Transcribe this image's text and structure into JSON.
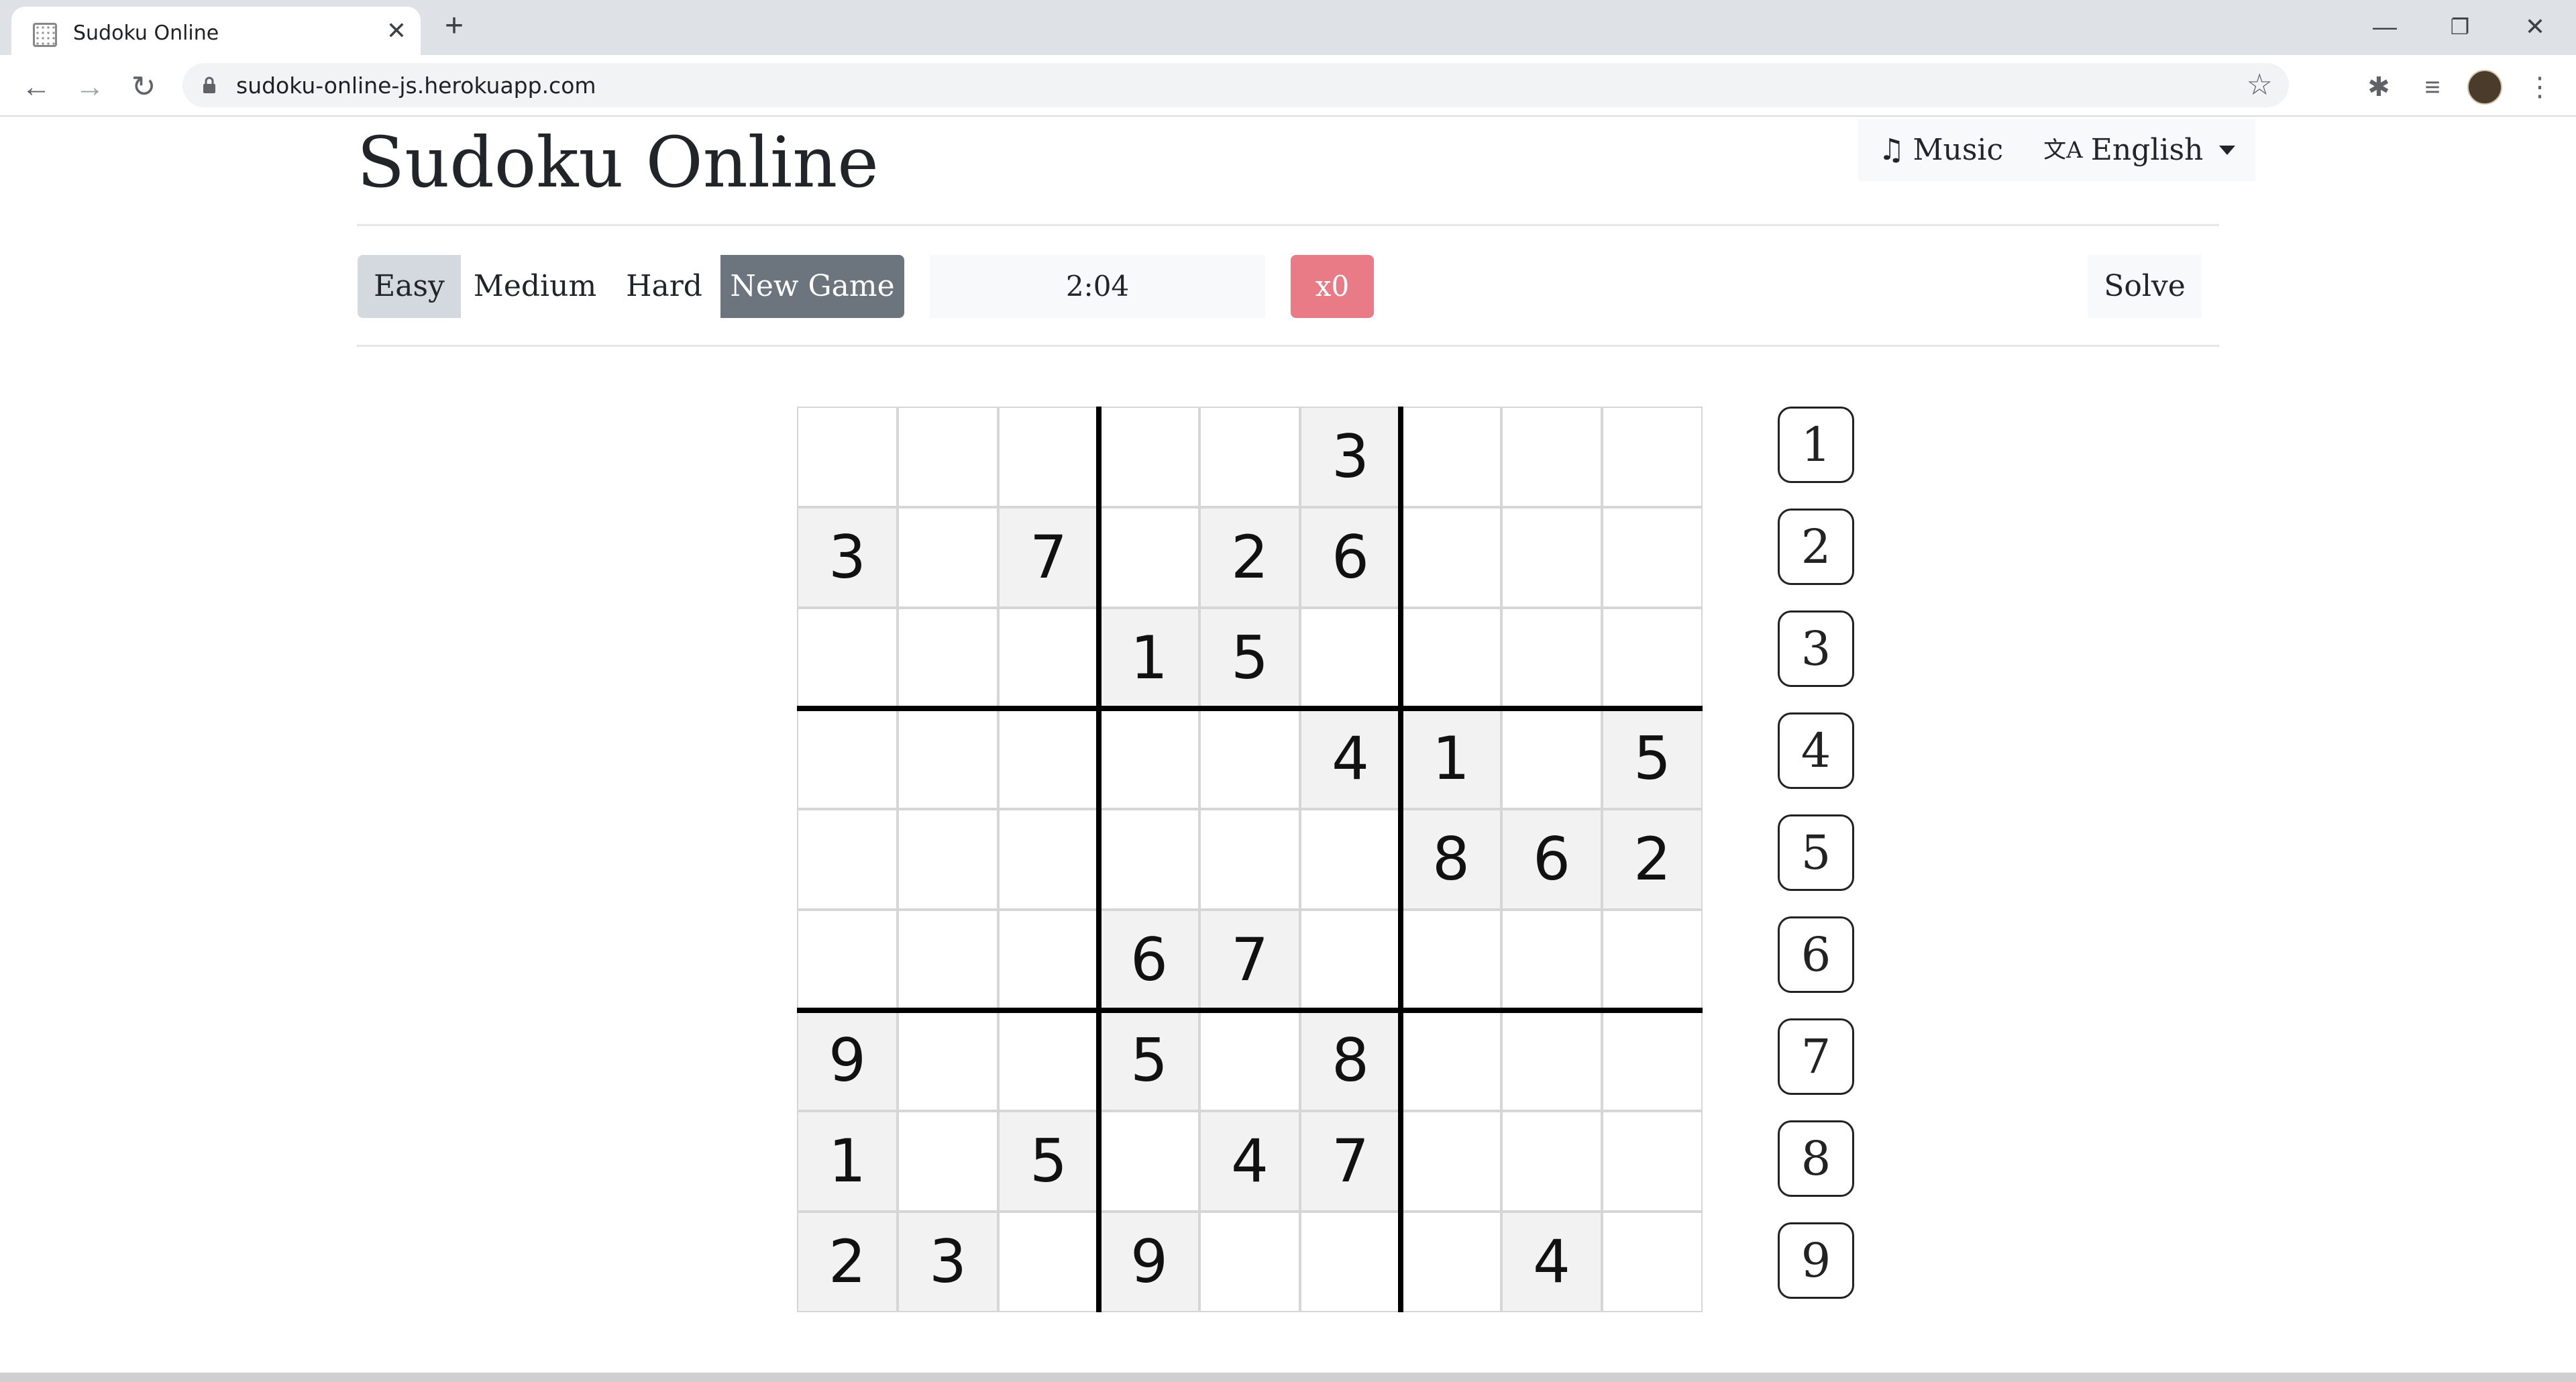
{
  "browser": {
    "tab_title": "Sudoku Online",
    "url": "sudoku-online-js.herokuapp.com"
  },
  "page": {
    "title": "Sudoku Online",
    "music_label": "Music",
    "language_label": "English",
    "difficulty": [
      "Easy",
      "Medium",
      "Hard"
    ],
    "selected_difficulty": "Easy",
    "new_game_label": "New Game",
    "timer": "2:04",
    "mistakes": "x0",
    "solve_label": "Solve"
  },
  "board": [
    [
      "",
      "",
      "",
      "",
      "",
      "3",
      "",
      "",
      ""
    ],
    [
      "3",
      "",
      "7",
      "",
      "2",
      "6",
      "",
      "",
      ""
    ],
    [
      "",
      "",
      "",
      "1",
      "5",
      "",
      "",
      "",
      ""
    ],
    [
      "",
      "",
      "",
      "",
      "",
      "4",
      "1",
      "",
      "5"
    ],
    [
      "",
      "",
      "",
      "",
      "",
      "",
      "8",
      "6",
      "2"
    ],
    [
      "",
      "",
      "",
      "6",
      "7",
      "",
      "",
      "",
      ""
    ],
    [
      "9",
      "",
      "",
      "5",
      "",
      "8",
      "",
      "",
      ""
    ],
    [
      "1",
      "",
      "5",
      "",
      "4",
      "7",
      "",
      "",
      ""
    ],
    [
      "2",
      "3",
      "",
      "9",
      "",
      "",
      "",
      "4",
      ""
    ]
  ],
  "numpad": [
    "1",
    "2",
    "3",
    "4",
    "5",
    "6",
    "7",
    "8",
    "9"
  ],
  "colors": {
    "given_cell_bg": "#f2f2f2",
    "new_game_bg": "#6c757d",
    "mistakes_bg": "#e97b86",
    "selected_difficulty_bg": "#d3d9df"
  }
}
